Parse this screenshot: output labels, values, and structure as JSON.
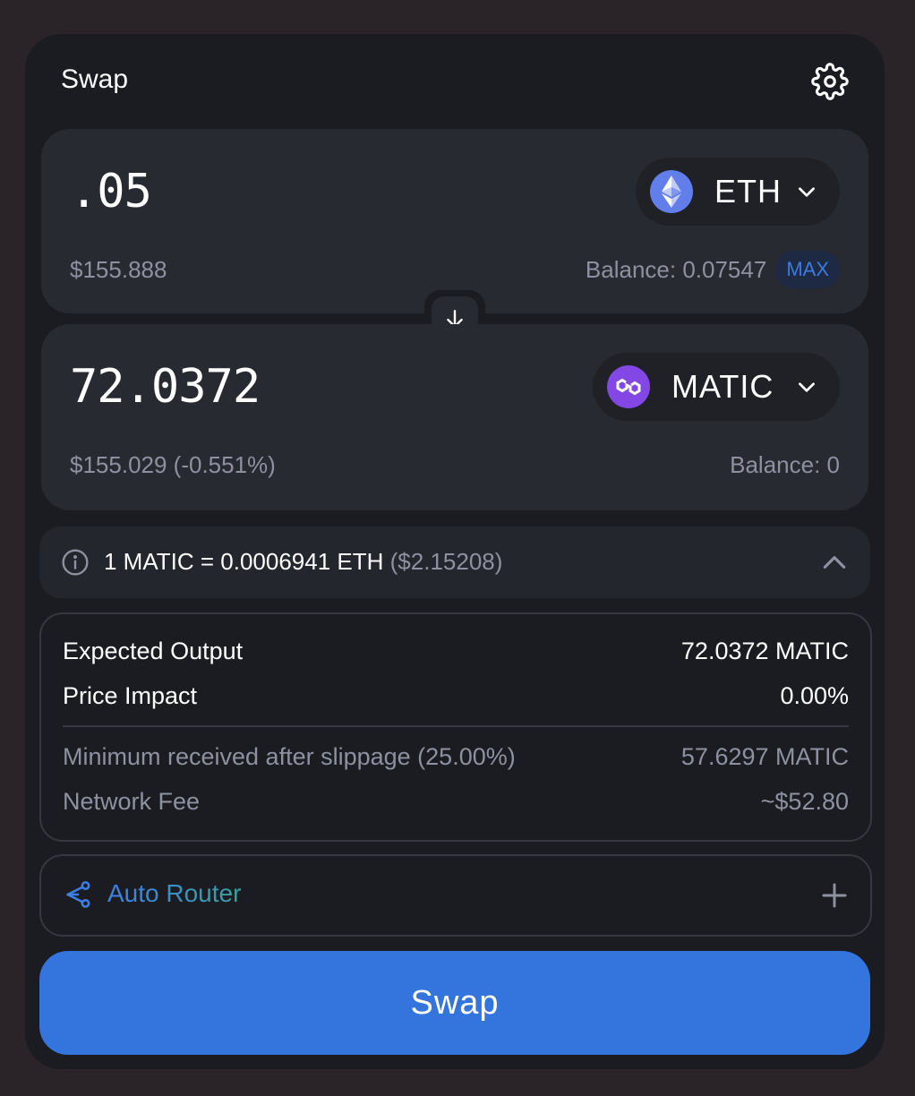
{
  "header": {
    "title": "Swap",
    "settings_icon": "gear-icon"
  },
  "input": {
    "amount": ".05",
    "usd_value": "$155.888",
    "token": {
      "symbol": "ETH",
      "logo_icon": "ethereum-logo-icon",
      "logo_color": "#627eea"
    },
    "balance_label": "Balance: 0.07547",
    "max_label": "MAX"
  },
  "switch": {
    "icon": "arrow-down-icon"
  },
  "output": {
    "amount": "72.0372",
    "usd_value": "$155.029 (-0.551%)",
    "token": {
      "symbol": "MATIC",
      "logo_icon": "polygon-logo-icon",
      "logo_color": "#8247e5"
    },
    "balance_label": "Balance: 0"
  },
  "rate": {
    "text": "1 MATIC = 0.0006941 ETH",
    "usd": "($2.15208)",
    "info_icon": "info-icon",
    "toggle_icon": "chevron-up-icon"
  },
  "details": {
    "expected_output_label": "Expected Output",
    "expected_output_value": "72.0372 MATIC",
    "price_impact_label": "Price Impact",
    "price_impact_value": "0.00%",
    "min_received_label": "Minimum received after slippage (25.00%)",
    "min_received_value": "57.6297 MATIC",
    "network_fee_label": "Network Fee",
    "network_fee_value": "~$52.80"
  },
  "router": {
    "label": "Auto Router",
    "icon": "route-icon",
    "expand_icon": "plus-icon"
  },
  "action": {
    "swap_label": "Swap",
    "color": "#3474dd"
  }
}
